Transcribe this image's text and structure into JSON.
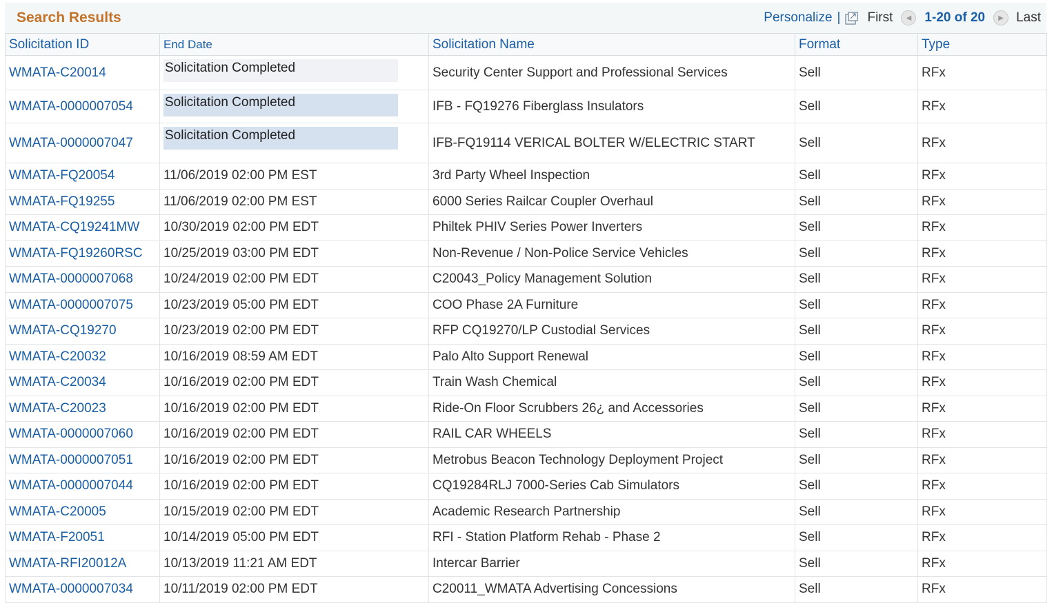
{
  "grid": {
    "title": "Search Results",
    "nav": {
      "personalize": "Personalize",
      "separator": "|",
      "first": "First",
      "range": "1-20 of 20",
      "last": "Last",
      "popout_icon": "popout-window-icon",
      "prev_icon": "arrow-left-icon",
      "next_icon": "arrow-right-icon"
    },
    "columns": {
      "id": "Solicitation ID",
      "end_date": "End Date",
      "name": "Solicitation Name",
      "format": "Format",
      "type": "Type"
    },
    "rows": [
      {
        "id": "WMATA-C20014",
        "end_date": "Solicitation Completed",
        "name": "Security Center Support and Professional Services",
        "format": "Sell",
        "type": "RFx"
      },
      {
        "id": "WMATA-0000007054",
        "end_date": "Solicitation Completed",
        "name": "IFB - FQ19276 Fiberglass Insulators",
        "format": "Sell",
        "type": "RFx"
      },
      {
        "id": "WMATA-0000007047",
        "end_date": "Solicitation Completed",
        "name": "IFB-FQ19114 VERICAL BOLTER W/ELECTRIC START",
        "format": "Sell",
        "type": "RFx"
      },
      {
        "id": "WMATA-FQ20054",
        "end_date": "11/06/2019 02:00 PM EST",
        "name": "3rd Party Wheel Inspection",
        "format": "Sell",
        "type": "RFx"
      },
      {
        "id": "WMATA-FQ19255",
        "end_date": "11/06/2019 02:00 PM EST",
        "name": "6000 Series Railcar Coupler Overhaul",
        "format": "Sell",
        "type": "RFx"
      },
      {
        "id": "WMATA-CQ19241MW",
        "end_date": "10/30/2019 02:00 PM EDT",
        "name": "Philtek PHIV Series Power Inverters",
        "format": "Sell",
        "type": "RFx"
      },
      {
        "id": "WMATA-FQ19260RSC",
        "end_date": "10/25/2019 03:00 PM EDT",
        "name": "Non-Revenue / Non-Police Service Vehicles",
        "format": "Sell",
        "type": "RFx"
      },
      {
        "id": "WMATA-0000007068",
        "end_date": "10/24/2019 02:00 PM EDT",
        "name": "C20043_Policy Management Solution",
        "format": "Sell",
        "type": "RFx"
      },
      {
        "id": "WMATA-0000007075",
        "end_date": "10/23/2019 05:00 PM EDT",
        "name": "COO Phase 2A Furniture",
        "format": "Sell",
        "type": "RFx"
      },
      {
        "id": "WMATA-CQ19270",
        "end_date": "10/23/2019 02:00 PM EDT",
        "name": "RFP CQ19270/LP Custodial Services",
        "format": "Sell",
        "type": "RFx"
      },
      {
        "id": "WMATA-C20032",
        "end_date": "10/16/2019 08:59 AM EDT",
        "name": "Palo Alto Support Renewal",
        "format": "Sell",
        "type": "RFx"
      },
      {
        "id": "WMATA-C20034",
        "end_date": "10/16/2019 02:00 PM EDT",
        "name": "Train Wash Chemical",
        "format": "Sell",
        "type": "RFx"
      },
      {
        "id": "WMATA-C20023",
        "end_date": "10/16/2019 02:00 PM EDT",
        "name": "Ride-On Floor Scrubbers 26¿ and Accessories",
        "format": "Sell",
        "type": "RFx"
      },
      {
        "id": "WMATA-0000007060",
        "end_date": "10/16/2019 02:00 PM EDT",
        "name": "RAIL CAR WHEELS",
        "format": "Sell",
        "type": "RFx"
      },
      {
        "id": "WMATA-0000007051",
        "end_date": "10/16/2019 02:00 PM EDT",
        "name": "Metrobus Beacon Technology Deployment Project",
        "format": "Sell",
        "type": "RFx"
      },
      {
        "id": "WMATA-0000007044",
        "end_date": "10/16/2019 02:00 PM EDT",
        "name": "CQ19284RLJ 7000-Series Cab Simulators",
        "format": "Sell",
        "type": "RFx"
      },
      {
        "id": "WMATA-C20005",
        "end_date": "10/15/2019 02:00 PM EDT",
        "name": "Academic Research Partnership",
        "format": "Sell",
        "type": "RFx"
      },
      {
        "id": "WMATA-F20051",
        "end_date": "10/14/2019 05:00 PM EDT",
        "name": "RFI - Station Platform Rehab - Phase 2",
        "format": "Sell",
        "type": "RFx"
      },
      {
        "id": "WMATA-RFI20012A",
        "end_date": "10/13/2019 11:21 AM EDT",
        "name": "Intercar Barrier",
        "format": "Sell",
        "type": "RFx"
      },
      {
        "id": "WMATA-0000007034",
        "end_date": "10/11/2019 02:00 PM EDT",
        "name": "C20011_WMATA Advertising Concessions",
        "format": "Sell",
        "type": "RFx"
      }
    ]
  }
}
